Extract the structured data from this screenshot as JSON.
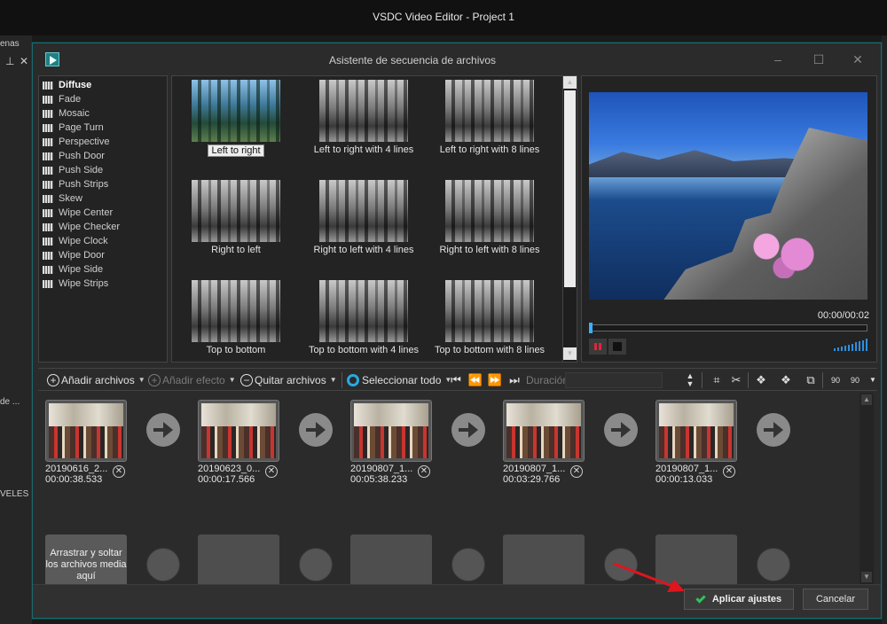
{
  "app": {
    "title": "VSDC Video Editor - Project 1"
  },
  "background_fragments": {
    "menu_fragment": "enas",
    "tab_fragment": "de ...",
    "levels_fragment": "VELES"
  },
  "dialog": {
    "title": "Asistente de secuencia de archivos",
    "window_controls": {
      "minimize": "–",
      "maximize": "☐",
      "close": "✕"
    }
  },
  "effects": [
    {
      "label": "Diffuse",
      "selected": true
    },
    {
      "label": "Fade"
    },
    {
      "label": "Mosaic"
    },
    {
      "label": "Page Turn"
    },
    {
      "label": "Perspective"
    },
    {
      "label": "Push Door"
    },
    {
      "label": "Push Side"
    },
    {
      "label": "Push Strips"
    },
    {
      "label": "Skew"
    },
    {
      "label": "Wipe Center"
    },
    {
      "label": "Wipe Checker"
    },
    {
      "label": "Wipe Clock"
    },
    {
      "label": "Wipe Door"
    },
    {
      "label": "Wipe Side"
    },
    {
      "label": "Wipe Strips"
    }
  ],
  "thumbnails": [
    {
      "label": "Left to right",
      "selected": true
    },
    {
      "label": "Left to right with 4 lines"
    },
    {
      "label": "Left to right with 8 lines"
    },
    {
      "label": "Right to left"
    },
    {
      "label": "Right to left with 4 lines"
    },
    {
      "label": "Right to left with 8 lines"
    },
    {
      "label": "Top to bottom"
    },
    {
      "label": "Top to bottom with 4 lines"
    },
    {
      "label": "Top to bottom with 8 lines"
    }
  ],
  "preview": {
    "time": "00:00/00:02",
    "position": 0.0
  },
  "toolbar": {
    "add_files": "Añadir archivos",
    "add_effect": "Añadir efecto",
    "remove_files": "Quitar archivos",
    "select_all": "Seleccionar todo",
    "duration_label": "Duración",
    "nav_first": "⏮",
    "nav_prev": "⏪",
    "nav_next": "⏩",
    "nav_last": "⏭",
    "rotate_90_left": "90",
    "rotate_90_right": "90"
  },
  "clips": [
    {
      "name": "20190616_2...",
      "duration": "00:00:38.533"
    },
    {
      "name": "20190623_0...",
      "duration": "00:00:17.566"
    },
    {
      "name": "20190807_1...",
      "duration": "00:05:38.233"
    },
    {
      "name": "20190807_1...",
      "duration": "00:03:29.766"
    },
    {
      "name": "20190807_1...",
      "duration": "00:00:13.033"
    }
  ],
  "drop_zone": {
    "text": "Arrastrar y soltar los archivos media aquí"
  },
  "footer": {
    "apply": "Aplicar ajustes",
    "cancel": "Cancelar"
  },
  "colors": {
    "accent": "#1b6a6e",
    "apply_check": "#2fc35a",
    "annotation_arrow": "#e0141e"
  }
}
